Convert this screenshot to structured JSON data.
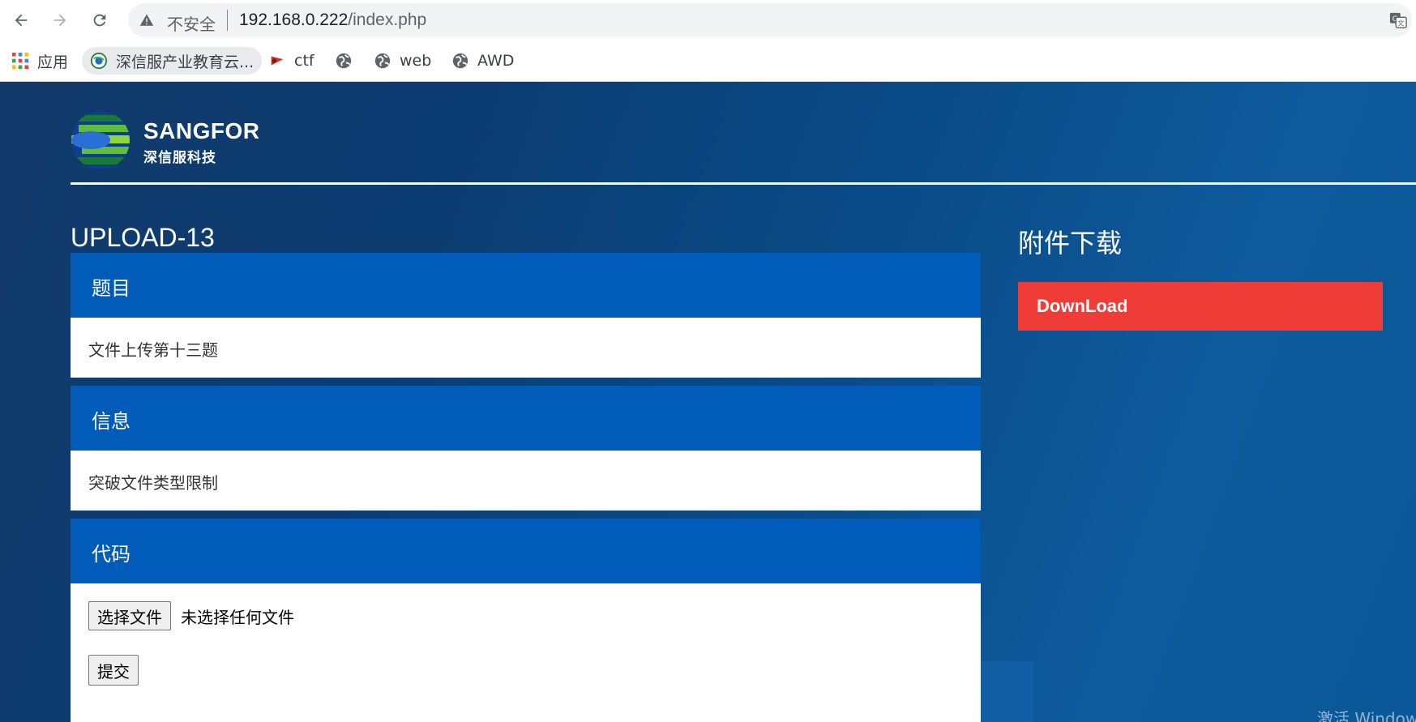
{
  "browser": {
    "insecure_label": "不安全",
    "url_host": "192.168.0.222",
    "url_path": "/index.php"
  },
  "bookmarks": [
    {
      "label": "应用",
      "icon": "apps-grid-icon"
    },
    {
      "label": "深信服产业教育云...",
      "icon": "sangfor-cloud-icon"
    },
    {
      "label": "ctf",
      "icon": "ctf-icon"
    },
    {
      "label": "",
      "icon": "globe-icon"
    },
    {
      "label": "web",
      "icon": "globe-icon"
    },
    {
      "label": "AWD",
      "icon": "globe-icon"
    }
  ],
  "logo": {
    "brand": "SANGFOR",
    "brand_cn": "深信服科技"
  },
  "main": {
    "title": "UPLOAD-13",
    "sections": [
      {
        "heading": "题目",
        "body": "文件上传第十三题"
      },
      {
        "heading": "信息",
        "body": "突破文件类型限制"
      },
      {
        "heading": "代码",
        "body": ""
      }
    ],
    "file_button": "选择文件",
    "no_file_text": "未选择任何文件",
    "submit_button": "提交"
  },
  "sidebar": {
    "title": "附件下载",
    "download_label": "DownLoad"
  },
  "watermark": "激活 Window",
  "colors": {
    "panel_head": "#005cb8",
    "download_button": "#f03c36",
    "page_bg": "#0b3d73"
  }
}
